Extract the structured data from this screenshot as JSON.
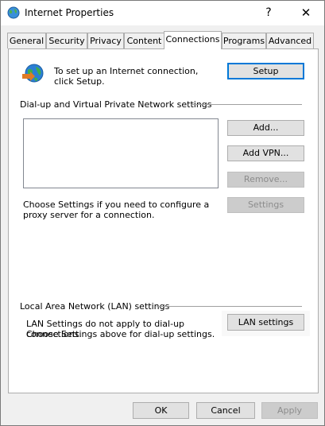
{
  "window": {
    "title": "Internet Properties",
    "help_glyph": "?",
    "close_glyph": "✕"
  },
  "tabs": [
    {
      "label": "General"
    },
    {
      "label": "Security"
    },
    {
      "label": "Privacy"
    },
    {
      "label": "Content"
    },
    {
      "label": "Connections"
    },
    {
      "label": "Programs"
    },
    {
      "label": "Advanced"
    }
  ],
  "active_tab": "Connections",
  "setup": {
    "text": "To set up an Internet connection, click Setup.",
    "button": "Setup"
  },
  "dialup": {
    "section_label": "Dial-up and Virtual Private Network settings",
    "add_button": "Add...",
    "add_vpn_button": "Add VPN...",
    "remove_button": "Remove...",
    "settings_button": "Settings",
    "proxy_text": "Choose Settings if you need to configure a proxy server for a connection."
  },
  "lan": {
    "section_label": "Local Area Network (LAN) settings",
    "text_line1": "LAN Settings do not apply to dial-up connections.",
    "text_line2": "Choose Settings above for dial-up settings.",
    "button": "LAN settings"
  },
  "footer": {
    "ok": "OK",
    "cancel": "Cancel",
    "apply": "Apply"
  },
  "colors": {
    "accent": "#0078d7",
    "disabled_text": "#8c8c8c"
  }
}
